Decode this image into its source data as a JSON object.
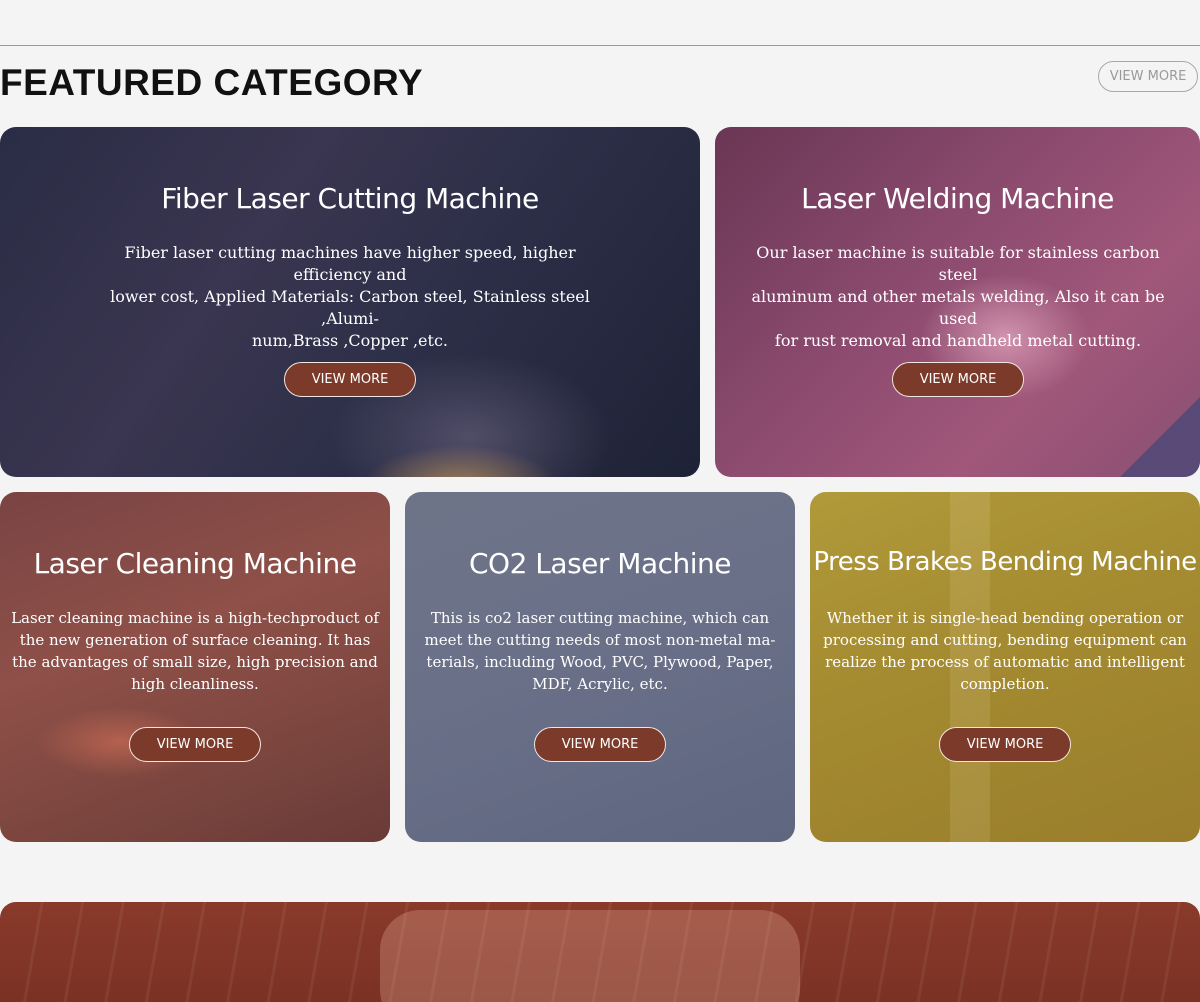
{
  "header": {
    "title": "FEATURED CATEGORY",
    "view_more_label": "VIEW MORE"
  },
  "cards": [
    {
      "title": "Fiber Laser Cutting Machine",
      "desc_lines": [
        "Fiber laser cutting machines have higher speed, higher efficiency and",
        "lower cost, Applied Materials: Carbon steel, Stainless steel ,Alumi-",
        "num,Brass ,Copper ,etc."
      ],
      "button_label": "VIEW MORE"
    },
    {
      "title": "Laser Welding Machine",
      "desc_lines": [
        "Our laser machine is suitable for stainless carbon steel",
        "aluminum and other metals welding, Also it can be used",
        "for rust removal and handheld metal cutting."
      ],
      "button_label": "VIEW MORE"
    },
    {
      "title": "Laser Cleaning Machine",
      "desc_lines": [
        "Laser cleaning machine is a high-techproduct of",
        "the new generation of surface cleaning. It has",
        "the advantages of small size, high precision and",
        "high cleanliness."
      ],
      "button_label": "VIEW MORE"
    },
    {
      "title": "CO2 Laser Machine",
      "desc_lines": [
        "This is co2 laser cutting machine, which can",
        "meet the cutting needs of most non-metal ma-",
        "terials, including Wood, PVC, Plywood, Paper,",
        "MDF,  Acrylic, etc."
      ],
      "button_label": "VIEW MORE"
    },
    {
      "title": "Press Brakes Bending Machine",
      "desc_lines": [
        "Whether it is single-head bending operation or",
        "processing and cutting, bending equipment can",
        "realize the process of automatic and intelligent",
        "completion."
      ],
      "button_label": "VIEW MORE"
    }
  ],
  "colors": {
    "button_bg": "#7c3a2a",
    "page_bg": "#f4f4f4"
  }
}
